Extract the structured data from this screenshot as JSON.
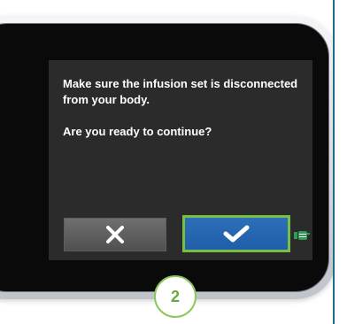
{
  "dialog": {
    "message_line1": "Make sure the infusion set is disconnected from your body.",
    "message_line2": "Are you ready to continue?"
  },
  "buttons": {
    "cancel_icon": "x-icon",
    "confirm_icon": "checkmark-icon"
  },
  "step_badge": "2",
  "colors": {
    "screen_background": "#2b2b2b",
    "confirm_button": "#1f5ea8",
    "highlight_border": "#77c043",
    "step_badge_accent": "#8cc75c",
    "pointer": "#2f9b56"
  }
}
